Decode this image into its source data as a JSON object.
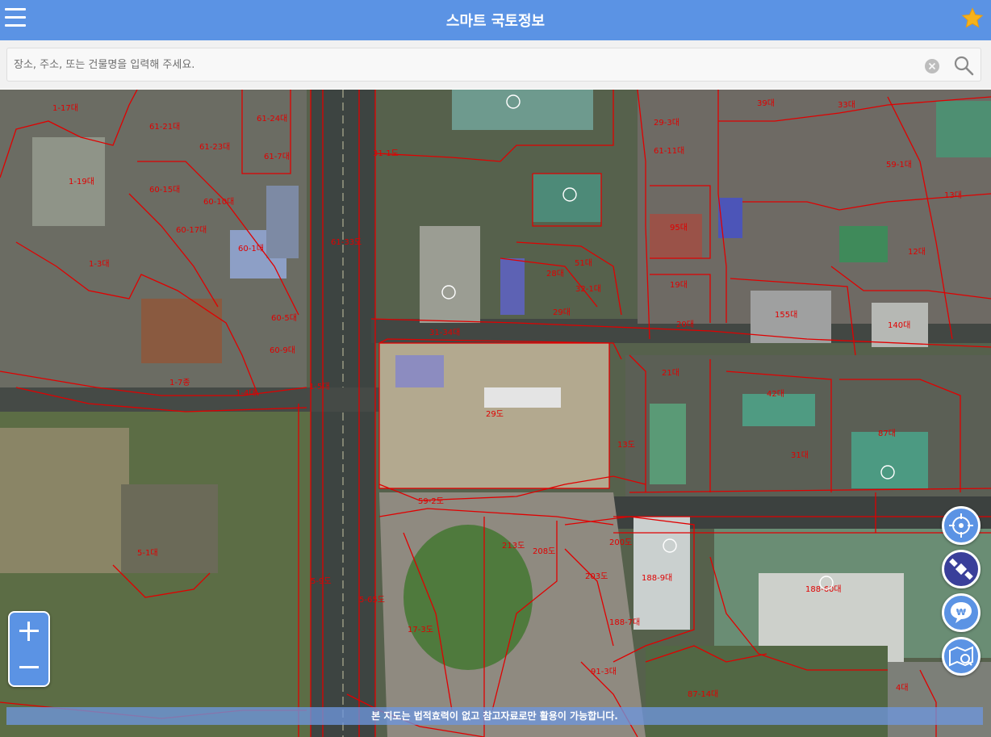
{
  "app": {
    "title": "스마트 국토정보",
    "menu_icon": "hamburger-menu-icon",
    "favorite_icon": "star-icon",
    "accent_color": "#5b93e4"
  },
  "search": {
    "placeholder": "장소, 주소, 또는 건물명을 입력해 주세요.",
    "value": "",
    "clear_icon": "clear-circle-icon",
    "search_icon": "magnifier-icon"
  },
  "map": {
    "layer": "aerial-with-cadastral-lines",
    "boundary_color": "#e00000",
    "parcel_labels": [
      "1-17대",
      "61-21대",
      "61-23대",
      "61-7대",
      "61-24대",
      "61-11대",
      "1-19대",
      "60-15대",
      "60-10대",
      "60-17대",
      "60-1대",
      "1-3대",
      "60-5대",
      "60-9대",
      "1-7종",
      "1-4대",
      "1-5대",
      "5-1대",
      "5-9도",
      "5-65도",
      "17-3도",
      "61-33도",
      "31-34대",
      "31-1도",
      "28대",
      "51대",
      "32-1대",
      "29대",
      "95대",
      "19대",
      "20대",
      "155대",
      "140대",
      "42대",
      "87대",
      "29도",
      "21대",
      "31대",
      "59-2도",
      "13도",
      "213도",
      "208도",
      "200도",
      "203도",
      "188-9대",
      "188-7대",
      "188-60대",
      "91-3대",
      "87-14대",
      "33대",
      "39대",
      "59-1대",
      "29-3대",
      "12대",
      "13대",
      "4대"
    ]
  },
  "controls": {
    "zoom_in": "+",
    "zoom_out": "−",
    "buttons": [
      "location-target-icon",
      "satellite-icon",
      "won-currency-icon",
      "map-search-icon"
    ]
  },
  "notice": {
    "text": "본 지도는 법적효력이 없고 참고자료로만 활용이 가능합니다."
  }
}
